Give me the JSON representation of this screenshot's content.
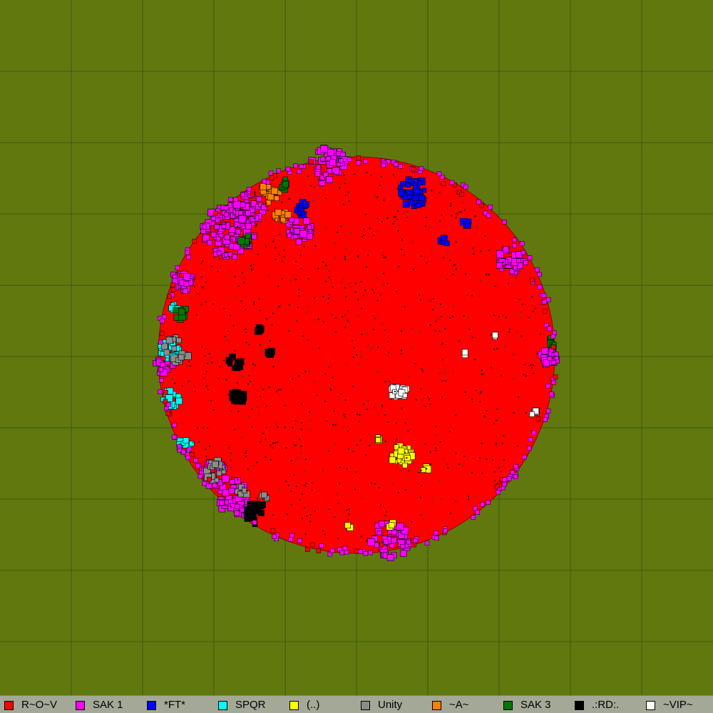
{
  "map": {
    "background_color": "#61780e",
    "grid_color": "#3a5a0e",
    "tribes": [
      {
        "key": "rov",
        "name": "R~O~V",
        "color": "#ff0000"
      },
      {
        "key": "sak1",
        "name": "SAK 1",
        "color": "#ff00ff"
      },
      {
        "key": "ft",
        "name": "*FT*",
        "color": "#0000ff"
      },
      {
        "key": "spqr",
        "name": "SPQR",
        "color": "#00ffff"
      },
      {
        "key": "dots",
        "name": "(..)",
        "color": "#ffff00"
      },
      {
        "key": "unity",
        "name": "Unity",
        "color": "#8c8c8c"
      },
      {
        "key": "a",
        "name": "~A~",
        "color": "#ff8000"
      },
      {
        "key": "sak3",
        "name": "SAK 3",
        "color": "#007800"
      },
      {
        "key": "rd",
        "name": ".:RD:.",
        "color": "#000000"
      },
      {
        "key": "vip",
        "name": "~VIP~",
        "color": "#ffffff"
      }
    ]
  }
}
